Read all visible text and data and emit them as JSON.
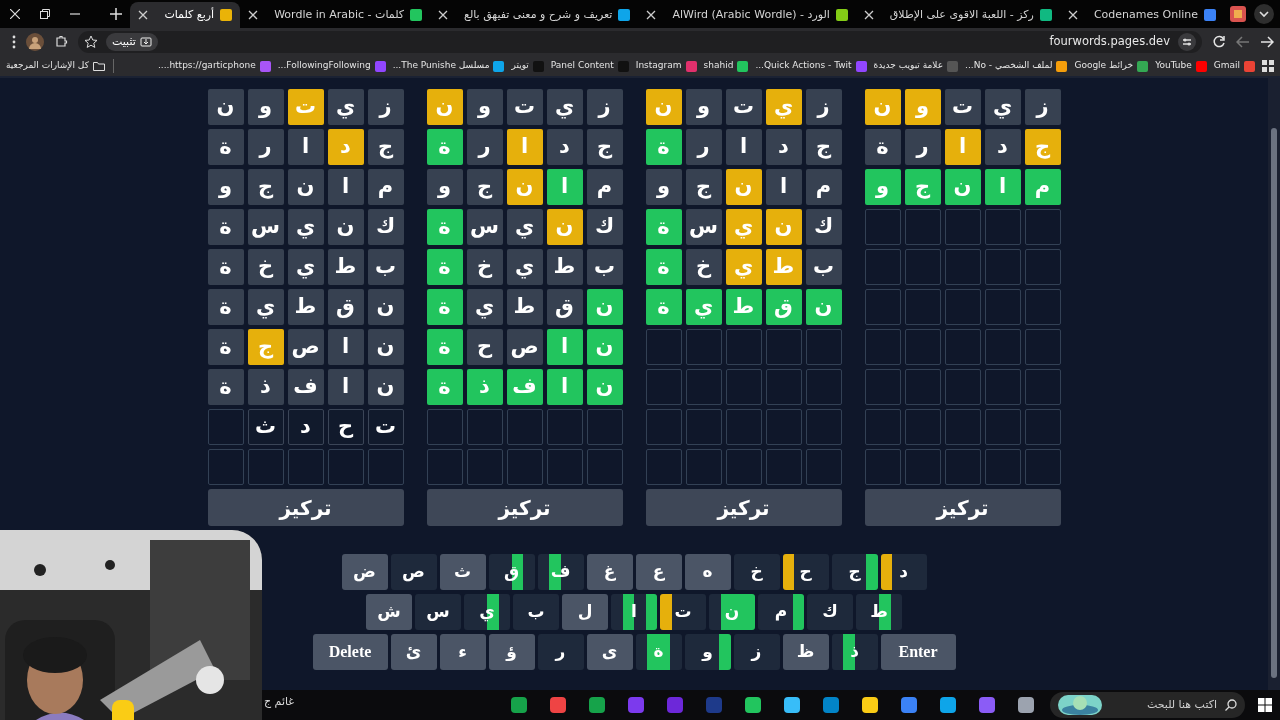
{
  "browser": {
    "tabs": [
      {
        "title": "Codenames Online",
        "selected": false
      },
      {
        "title": "ركز - اللعبة الاقوى على الإطلاق",
        "selected": false
      },
      {
        "title": "الورد - AlWird (Arabic Wordle)",
        "selected": false
      },
      {
        "title": "تعريف و شرح و معنى تفيهق بالع",
        "selected": false
      },
      {
        "title": "كلمات - Wordle in Arabic",
        "selected": false
      },
      {
        "title": "أربع كلمات",
        "selected": true
      }
    ],
    "url": "fourwords.pages.dev",
    "install_button": "تثبيت",
    "bookmarks": [
      "Gmail",
      "YouTube",
      "خرائط Google",
      "لملف الشخصي - No...",
      "علامة تبويب جديدة",
      "Quick Actions - Twit...",
      "shahid",
      "Instagram",
      "Panel Content",
      "تويتر",
      "مسلسل The Punishe...",
      "FollowingFollowing...",
      "https://garticphone...."
    ],
    "all_bookmarks": "كل الإشارات المرجعية"
  },
  "boards": [
    {
      "button": "تركيز",
      "rows": [
        {
          "kind": "guess",
          "tiles": [
            {
              "letter": "ز",
              "color": "#374151"
            },
            {
              "letter": "ي",
              "color": "#374151"
            },
            {
              "letter": "ت",
              "color": "#374151"
            },
            {
              "letter": "و",
              "color": "#e6b00c"
            },
            {
              "letter": "ن",
              "color": "#e6b00c"
            }
          ]
        },
        {
          "kind": "guess",
          "tiles": [
            {
              "letter": "ج",
              "color": "#e6b00c"
            },
            {
              "letter": "د",
              "color": "#374151"
            },
            {
              "letter": "ا",
              "color": "#e6b00c"
            },
            {
              "letter": "ر",
              "color": "#374151"
            },
            {
              "letter": "ة",
              "color": "#374151"
            }
          ]
        },
        {
          "kind": "guess",
          "tiles": [
            {
              "letter": "م",
              "color": "#22c55e"
            },
            {
              "letter": "ا",
              "color": "#22c55e"
            },
            {
              "letter": "ن",
              "color": "#22c55e"
            },
            {
              "letter": "ج",
              "color": "#22c55e"
            },
            {
              "letter": "و",
              "color": "#22c55e"
            }
          ]
        },
        {
          "kind": "empty"
        },
        {
          "kind": "empty"
        },
        {
          "kind": "empty"
        },
        {
          "kind": "empty"
        },
        {
          "kind": "empty"
        },
        {
          "kind": "empty"
        },
        {
          "kind": "empty"
        }
      ]
    },
    {
      "button": "تركيز",
      "rows": [
        {
          "kind": "guess",
          "tiles": [
            {
              "letter": "ز",
              "color": "#374151"
            },
            {
              "letter": "ي",
              "color": "#e6b00c"
            },
            {
              "letter": "ت",
              "color": "#374151"
            },
            {
              "letter": "و",
              "color": "#374151"
            },
            {
              "letter": "ن",
              "color": "#e6b00c"
            }
          ]
        },
        {
          "kind": "guess",
          "tiles": [
            {
              "letter": "ج",
              "color": "#374151"
            },
            {
              "letter": "د",
              "color": "#374151"
            },
            {
              "letter": "ا",
              "color": "#374151"
            },
            {
              "letter": "ر",
              "color": "#374151"
            },
            {
              "letter": "ة",
              "color": "#22c55e"
            }
          ]
        },
        {
          "kind": "guess",
          "tiles": [
            {
              "letter": "م",
              "color": "#374151"
            },
            {
              "letter": "ا",
              "color": "#374151"
            },
            {
              "letter": "ن",
              "color": "#e6b00c"
            },
            {
              "letter": "ج",
              "color": "#374151"
            },
            {
              "letter": "و",
              "color": "#374151"
            }
          ]
        },
        {
          "kind": "guess",
          "tiles": [
            {
              "letter": "ك",
              "color": "#374151"
            },
            {
              "letter": "ن",
              "color": "#e6b00c"
            },
            {
              "letter": "ي",
              "color": "#e6b00c"
            },
            {
              "letter": "س",
              "color": "#374151"
            },
            {
              "letter": "ة",
              "color": "#22c55e"
            }
          ]
        },
        {
          "kind": "guess",
          "tiles": [
            {
              "letter": "ب",
              "color": "#374151"
            },
            {
              "letter": "ط",
              "color": "#e6b00c"
            },
            {
              "letter": "ي",
              "color": "#e6b00c"
            },
            {
              "letter": "خ",
              "color": "#374151"
            },
            {
              "letter": "ة",
              "color": "#22c55e"
            }
          ]
        },
        {
          "kind": "guess",
          "tiles": [
            {
              "letter": "ن",
              "color": "#22c55e"
            },
            {
              "letter": "ق",
              "color": "#22c55e"
            },
            {
              "letter": "ط",
              "color": "#22c55e"
            },
            {
              "letter": "ي",
              "color": "#22c55e"
            },
            {
              "letter": "ة",
              "color": "#22c55e"
            }
          ]
        },
        {
          "kind": "empty"
        },
        {
          "kind": "empty"
        },
        {
          "kind": "empty"
        },
        {
          "kind": "empty"
        }
      ]
    },
    {
      "button": "تركيز",
      "rows": [
        {
          "kind": "guess",
          "tiles": [
            {
              "letter": "ز",
              "color": "#374151"
            },
            {
              "letter": "ي",
              "color": "#374151"
            },
            {
              "letter": "ت",
              "color": "#374151"
            },
            {
              "letter": "و",
              "color": "#374151"
            },
            {
              "letter": "ن",
              "color": "#e6b00c"
            }
          ]
        },
        {
          "kind": "guess",
          "tiles": [
            {
              "letter": "ج",
              "color": "#374151"
            },
            {
              "letter": "د",
              "color": "#374151"
            },
            {
              "letter": "ا",
              "color": "#e6b00c"
            },
            {
              "letter": "ر",
              "color": "#374151"
            },
            {
              "letter": "ة",
              "color": "#22c55e"
            }
          ]
        },
        {
          "kind": "guess",
          "tiles": [
            {
              "letter": "م",
              "color": "#374151"
            },
            {
              "letter": "ا",
              "color": "#22c55e"
            },
            {
              "letter": "ن",
              "color": "#e6b00c"
            },
            {
              "letter": "ج",
              "color": "#374151"
            },
            {
              "letter": "و",
              "color": "#374151"
            }
          ]
        },
        {
          "kind": "guess",
          "tiles": [
            {
              "letter": "ك",
              "color": "#374151"
            },
            {
              "letter": "ن",
              "color": "#e6b00c"
            },
            {
              "letter": "ي",
              "color": "#374151"
            },
            {
              "letter": "س",
              "color": "#374151"
            },
            {
              "letter": "ة",
              "color": "#22c55e"
            }
          ]
        },
        {
          "kind": "guess",
          "tiles": [
            {
              "letter": "ب",
              "color": "#374151"
            },
            {
              "letter": "ط",
              "color": "#374151"
            },
            {
              "letter": "ي",
              "color": "#374151"
            },
            {
              "letter": "خ",
              "color": "#374151"
            },
            {
              "letter": "ة",
              "color": "#22c55e"
            }
          ]
        },
        {
          "kind": "guess",
          "tiles": [
            {
              "letter": "ن",
              "color": "#22c55e"
            },
            {
              "letter": "ق",
              "color": "#374151"
            },
            {
              "letter": "ط",
              "color": "#374151"
            },
            {
              "letter": "ي",
              "color": "#374151"
            },
            {
              "letter": "ة",
              "color": "#22c55e"
            }
          ]
        },
        {
          "kind": "guess",
          "tiles": [
            {
              "letter": "ن",
              "color": "#22c55e"
            },
            {
              "letter": "ا",
              "color": "#22c55e"
            },
            {
              "letter": "ص",
              "color": "#374151"
            },
            {
              "letter": "ح",
              "color": "#374151"
            },
            {
              "letter": "ة",
              "color": "#22c55e"
            }
          ]
        },
        {
          "kind": "guess",
          "tiles": [
            {
              "letter": "ن",
              "color": "#22c55e"
            },
            {
              "letter": "ا",
              "color": "#22c55e"
            },
            {
              "letter": "ف",
              "color": "#22c55e"
            },
            {
              "letter": "ذ",
              "color": "#22c55e"
            },
            {
              "letter": "ة",
              "color": "#22c55e"
            }
          ]
        },
        {
          "kind": "empty"
        },
        {
          "kind": "empty"
        }
      ]
    },
    {
      "button": "تركيز",
      "rows": [
        {
          "kind": "guess",
          "tiles": [
            {
              "letter": "ز",
              "color": "#374151"
            },
            {
              "letter": "ي",
              "color": "#374151"
            },
            {
              "letter": "ت",
              "color": "#e6b00c"
            },
            {
              "letter": "و",
              "color": "#374151"
            },
            {
              "letter": "ن",
              "color": "#374151"
            }
          ]
        },
        {
          "kind": "guess",
          "tiles": [
            {
              "letter": "ج",
              "color": "#374151"
            },
            {
              "letter": "د",
              "color": "#e6b00c"
            },
            {
              "letter": "ا",
              "color": "#374151"
            },
            {
              "letter": "ر",
              "color": "#374151"
            },
            {
              "letter": "ة",
              "color": "#374151"
            }
          ]
        },
        {
          "kind": "guess",
          "tiles": [
            {
              "letter": "م",
              "color": "#374151"
            },
            {
              "letter": "ا",
              "color": "#374151"
            },
            {
              "letter": "ن",
              "color": "#374151"
            },
            {
              "letter": "ج",
              "color": "#374151"
            },
            {
              "letter": "و",
              "color": "#374151"
            }
          ]
        },
        {
          "kind": "guess",
          "tiles": [
            {
              "letter": "ك",
              "color": "#374151"
            },
            {
              "letter": "ن",
              "color": "#374151"
            },
            {
              "letter": "ي",
              "color": "#374151"
            },
            {
              "letter": "س",
              "color": "#374151"
            },
            {
              "letter": "ة",
              "color": "#374151"
            }
          ]
        },
        {
          "kind": "guess",
          "tiles": [
            {
              "letter": "ب",
              "color": "#374151"
            },
            {
              "letter": "ط",
              "color": "#374151"
            },
            {
              "letter": "ي",
              "color": "#374151"
            },
            {
              "letter": "خ",
              "color": "#374151"
            },
            {
              "letter": "ة",
              "color": "#374151"
            }
          ]
        },
        {
          "kind": "guess",
          "tiles": [
            {
              "letter": "ن",
              "color": "#374151"
            },
            {
              "letter": "ق",
              "color": "#374151"
            },
            {
              "letter": "ط",
              "color": "#374151"
            },
            {
              "letter": "ي",
              "color": "#374151"
            },
            {
              "letter": "ة",
              "color": "#374151"
            }
          ]
        },
        {
          "kind": "guess",
          "tiles": [
            {
              "letter": "ن",
              "color": "#374151"
            },
            {
              "letter": "ا",
              "color": "#374151"
            },
            {
              "letter": "ص",
              "color": "#374151"
            },
            {
              "letter": "ج",
              "color": "#e6b00c"
            },
            {
              "letter": "ة",
              "color": "#374151"
            }
          ]
        },
        {
          "kind": "guess",
          "tiles": [
            {
              "letter": "ن",
              "color": "#374151"
            },
            {
              "letter": "ا",
              "color": "#374151"
            },
            {
              "letter": "ف",
              "color": "#374151"
            },
            {
              "letter": "ذ",
              "color": "#374151"
            },
            {
              "letter": "ة",
              "color": "#374151"
            }
          ]
        },
        {
          "kind": "typing",
          "letters": [
            "ت",
            "ح",
            "د",
            "ث"
          ]
        },
        {
          "kind": "empty"
        }
      ]
    }
  ],
  "keyboard": {
    "rows": [
      {
        "keys": [
          {
            "label": "د",
            "used": true,
            "present": [
              false,
              false,
              false,
              true
            ]
          },
          {
            "label": "ج",
            "used": true,
            "correct": [
              true,
              false,
              false,
              false
            ]
          },
          {
            "label": "ح",
            "used": true,
            "present": [
              false,
              false,
              false,
              true
            ]
          },
          {
            "label": "خ",
            "used": true
          },
          {
            "label": "ه",
            "used": false
          },
          {
            "label": "ع",
            "used": false
          },
          {
            "label": "غ",
            "used": false
          },
          {
            "label": "ف",
            "used": true,
            "correct": [
              false,
              false,
              true,
              false
            ]
          },
          {
            "label": "ق",
            "used": true,
            "correct": [
              false,
              true,
              false,
              false
            ]
          },
          {
            "label": "ث",
            "used": false
          },
          {
            "label": "ص",
            "used": true
          },
          {
            "label": "ض",
            "used": false
          }
        ]
      },
      {
        "keys": [
          {
            "label": "ط",
            "used": true,
            "correct": [
              false,
              true,
              false,
              false
            ]
          },
          {
            "label": "ك",
            "used": true
          },
          {
            "label": "م",
            "used": true,
            "correct": [
              true,
              false,
              false,
              false
            ]
          },
          {
            "label": "ن",
            "used": true,
            "correct": [
              true,
              true,
              true,
              false
            ]
          },
          {
            "label": "ت",
            "used": true,
            "present": [
              false,
              false,
              false,
              true
            ]
          },
          {
            "label": "ا",
            "used": true,
            "correct": [
              true,
              false,
              true,
              false
            ]
          },
          {
            "label": "ل",
            "used": false
          },
          {
            "label": "ب",
            "used": true
          },
          {
            "label": "ي",
            "used": true,
            "correct": [
              false,
              true,
              false,
              false
            ]
          },
          {
            "label": "س",
            "used": true
          },
          {
            "label": "ش",
            "used": false
          }
        ]
      },
      {
        "keys": [
          {
            "label": "Enter",
            "kind": "action",
            "used": false
          },
          {
            "label": "ذ",
            "used": true,
            "correct": [
              false,
              false,
              true,
              false
            ]
          },
          {
            "label": "ظ",
            "used": false
          },
          {
            "label": "ز",
            "used": true
          },
          {
            "label": "و",
            "used": true,
            "correct": [
              true,
              false,
              false,
              false
            ]
          },
          {
            "label": "ة",
            "used": true,
            "correct": [
              false,
              true,
              true,
              false
            ]
          },
          {
            "label": "ى",
            "used": false
          },
          {
            "label": "ر",
            "used": true
          },
          {
            "label": "ؤ",
            "used": false
          },
          {
            "label": "ء",
            "used": false
          },
          {
            "label": "ئ",
            "used": false
          },
          {
            "label": "Delete",
            "kind": "action",
            "used": false
          }
        ]
      }
    ]
  },
  "taskbar": {
    "search_placeholder": "اكتب هنا للبحث",
    "weather": "غائم ج"
  }
}
